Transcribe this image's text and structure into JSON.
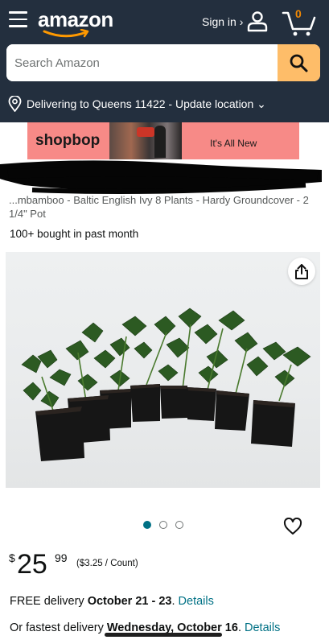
{
  "header": {
    "logo_text": "amazon",
    "signin_label": "Sign in ›",
    "cart_count": "0",
    "search": {
      "placeholder": "Search Amazon"
    },
    "delivery_location": "Delivering to Queens 11422 - Update location ⌄"
  },
  "banner": {
    "brand": "shopbop",
    "tagline": "It's All New"
  },
  "product": {
    "title": "...mbamboo - Baltic English Ivy 8 Plants - Hardy Groundcover - 2 1/4\" Pot",
    "bought": "100+ bought in past month",
    "image_alt": "Eight potted ivy plants in black square pots",
    "carousel": {
      "count": 3,
      "active": 0
    },
    "price": {
      "currency": "$",
      "whole": "25",
      "fraction": "99",
      "unit_price": "($3.25 / Count)"
    },
    "delivery": {
      "prefix": "FREE delivery ",
      "dates": "October 21 - 23",
      "suffix": ". ",
      "link": "Details"
    },
    "fastest": {
      "prefix": "Or fastest delivery ",
      "date": "Wednesday, October 16",
      "suffix": ". ",
      "link": "Details"
    }
  },
  "colors": {
    "header_bg": "#232f3e",
    "search_button": "#febd69",
    "cart_count": "#f08804",
    "banner_bg": "#f78a87",
    "link": "#007185",
    "dot_active": "#007185"
  },
  "icons": [
    "menu-icon",
    "user-icon",
    "cart-icon",
    "search-icon",
    "location-pin-icon",
    "share-icon",
    "heart-icon"
  ]
}
